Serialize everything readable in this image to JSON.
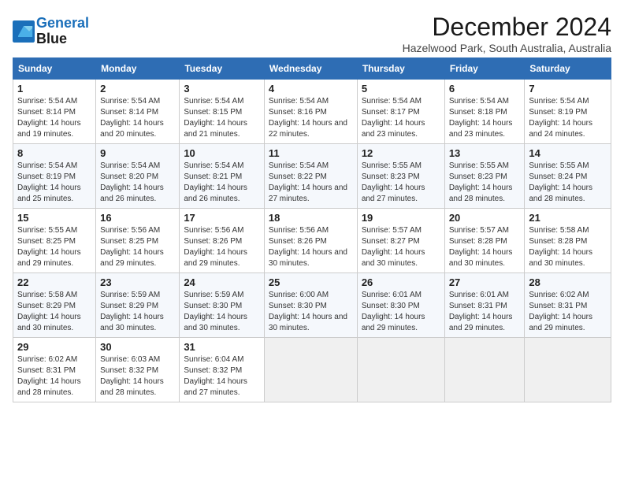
{
  "logo": {
    "line1": "General",
    "line2": "Blue"
  },
  "title": "December 2024",
  "location": "Hazelwood Park, South Australia, Australia",
  "days_of_week": [
    "Sunday",
    "Monday",
    "Tuesday",
    "Wednesday",
    "Thursday",
    "Friday",
    "Saturday"
  ],
  "weeks": [
    [
      {
        "day": 1,
        "sunrise": "5:54 AM",
        "sunset": "8:14 PM",
        "daylight": "14 hours and 19 minutes."
      },
      {
        "day": 2,
        "sunrise": "5:54 AM",
        "sunset": "8:14 PM",
        "daylight": "14 hours and 20 minutes."
      },
      {
        "day": 3,
        "sunrise": "5:54 AM",
        "sunset": "8:15 PM",
        "daylight": "14 hours and 21 minutes."
      },
      {
        "day": 4,
        "sunrise": "5:54 AM",
        "sunset": "8:16 PM",
        "daylight": "14 hours and 22 minutes."
      },
      {
        "day": 5,
        "sunrise": "5:54 AM",
        "sunset": "8:17 PM",
        "daylight": "14 hours and 23 minutes."
      },
      {
        "day": 6,
        "sunrise": "5:54 AM",
        "sunset": "8:18 PM",
        "daylight": "14 hours and 23 minutes."
      },
      {
        "day": 7,
        "sunrise": "5:54 AM",
        "sunset": "8:19 PM",
        "daylight": "14 hours and 24 minutes."
      }
    ],
    [
      {
        "day": 8,
        "sunrise": "5:54 AM",
        "sunset": "8:19 PM",
        "daylight": "14 hours and 25 minutes."
      },
      {
        "day": 9,
        "sunrise": "5:54 AM",
        "sunset": "8:20 PM",
        "daylight": "14 hours and 26 minutes."
      },
      {
        "day": 10,
        "sunrise": "5:54 AM",
        "sunset": "8:21 PM",
        "daylight": "14 hours and 26 minutes."
      },
      {
        "day": 11,
        "sunrise": "5:54 AM",
        "sunset": "8:22 PM",
        "daylight": "14 hours and 27 minutes."
      },
      {
        "day": 12,
        "sunrise": "5:55 AM",
        "sunset": "8:23 PM",
        "daylight": "14 hours and 27 minutes."
      },
      {
        "day": 13,
        "sunrise": "5:55 AM",
        "sunset": "8:23 PM",
        "daylight": "14 hours and 28 minutes."
      },
      {
        "day": 14,
        "sunrise": "5:55 AM",
        "sunset": "8:24 PM",
        "daylight": "14 hours and 28 minutes."
      }
    ],
    [
      {
        "day": 15,
        "sunrise": "5:55 AM",
        "sunset": "8:25 PM",
        "daylight": "14 hours and 29 minutes."
      },
      {
        "day": 16,
        "sunrise": "5:56 AM",
        "sunset": "8:25 PM",
        "daylight": "14 hours and 29 minutes."
      },
      {
        "day": 17,
        "sunrise": "5:56 AM",
        "sunset": "8:26 PM",
        "daylight": "14 hours and 29 minutes."
      },
      {
        "day": 18,
        "sunrise": "5:56 AM",
        "sunset": "8:26 PM",
        "daylight": "14 hours and 30 minutes."
      },
      {
        "day": 19,
        "sunrise": "5:57 AM",
        "sunset": "8:27 PM",
        "daylight": "14 hours and 30 minutes."
      },
      {
        "day": 20,
        "sunrise": "5:57 AM",
        "sunset": "8:28 PM",
        "daylight": "14 hours and 30 minutes."
      },
      {
        "day": 21,
        "sunrise": "5:58 AM",
        "sunset": "8:28 PM",
        "daylight": "14 hours and 30 minutes."
      }
    ],
    [
      {
        "day": 22,
        "sunrise": "5:58 AM",
        "sunset": "8:29 PM",
        "daylight": "14 hours and 30 minutes."
      },
      {
        "day": 23,
        "sunrise": "5:59 AM",
        "sunset": "8:29 PM",
        "daylight": "14 hours and 30 minutes."
      },
      {
        "day": 24,
        "sunrise": "5:59 AM",
        "sunset": "8:30 PM",
        "daylight": "14 hours and 30 minutes."
      },
      {
        "day": 25,
        "sunrise": "6:00 AM",
        "sunset": "8:30 PM",
        "daylight": "14 hours and 30 minutes."
      },
      {
        "day": 26,
        "sunrise": "6:01 AM",
        "sunset": "8:30 PM",
        "daylight": "14 hours and 29 minutes."
      },
      {
        "day": 27,
        "sunrise": "6:01 AM",
        "sunset": "8:31 PM",
        "daylight": "14 hours and 29 minutes."
      },
      {
        "day": 28,
        "sunrise": "6:02 AM",
        "sunset": "8:31 PM",
        "daylight": "14 hours and 29 minutes."
      }
    ],
    [
      {
        "day": 29,
        "sunrise": "6:02 AM",
        "sunset": "8:31 PM",
        "daylight": "14 hours and 28 minutes."
      },
      {
        "day": 30,
        "sunrise": "6:03 AM",
        "sunset": "8:32 PM",
        "daylight": "14 hours and 28 minutes."
      },
      {
        "day": 31,
        "sunrise": "6:04 AM",
        "sunset": "8:32 PM",
        "daylight": "14 hours and 27 minutes."
      },
      null,
      null,
      null,
      null
    ]
  ]
}
